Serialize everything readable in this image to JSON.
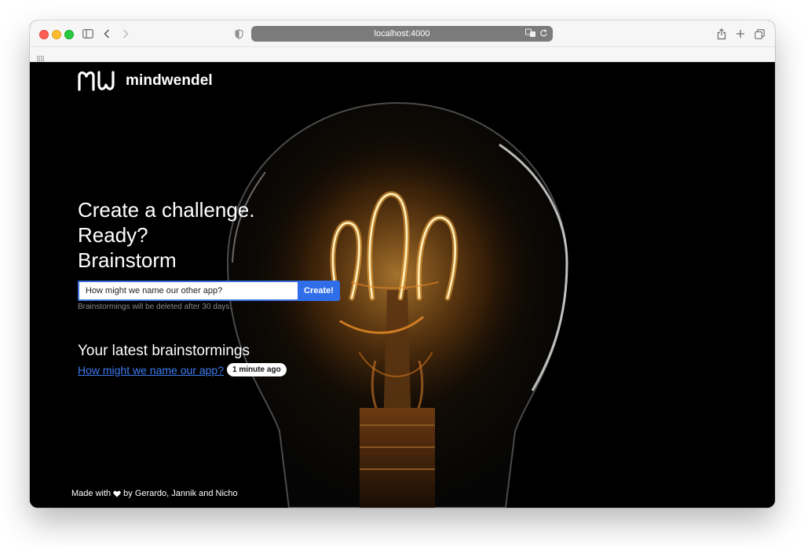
{
  "browser": {
    "url": "localhost:4000"
  },
  "brand": {
    "name": "mindwendel"
  },
  "hero": {
    "line1": "Create a challenge.",
    "line2": "Ready?",
    "line3": "Brainstorm"
  },
  "form": {
    "input_value": "How might we name our other app?",
    "submit_label": "Create!",
    "hint": "Brainstormings will be deleted after 30 days."
  },
  "latest": {
    "title": "Your latest brainstormings",
    "items": [
      {
        "label": "How might we name our app?",
        "time": "1 minute ago"
      }
    ]
  },
  "footer": {
    "prefix": "Made with",
    "suffix": "by Gerardo, Jannik and Nicho"
  },
  "colors": {
    "accent": "#2f6ee8",
    "link": "#3e7bf0",
    "page_bg": "#000000"
  },
  "icons": [
    "sidebar-icon",
    "chevron-left-icon",
    "chevron-right-icon",
    "shield-icon",
    "translate-icon",
    "reload-icon",
    "share-icon",
    "plus-icon",
    "tabs-icon",
    "grid-icon",
    "heart-icon"
  ]
}
